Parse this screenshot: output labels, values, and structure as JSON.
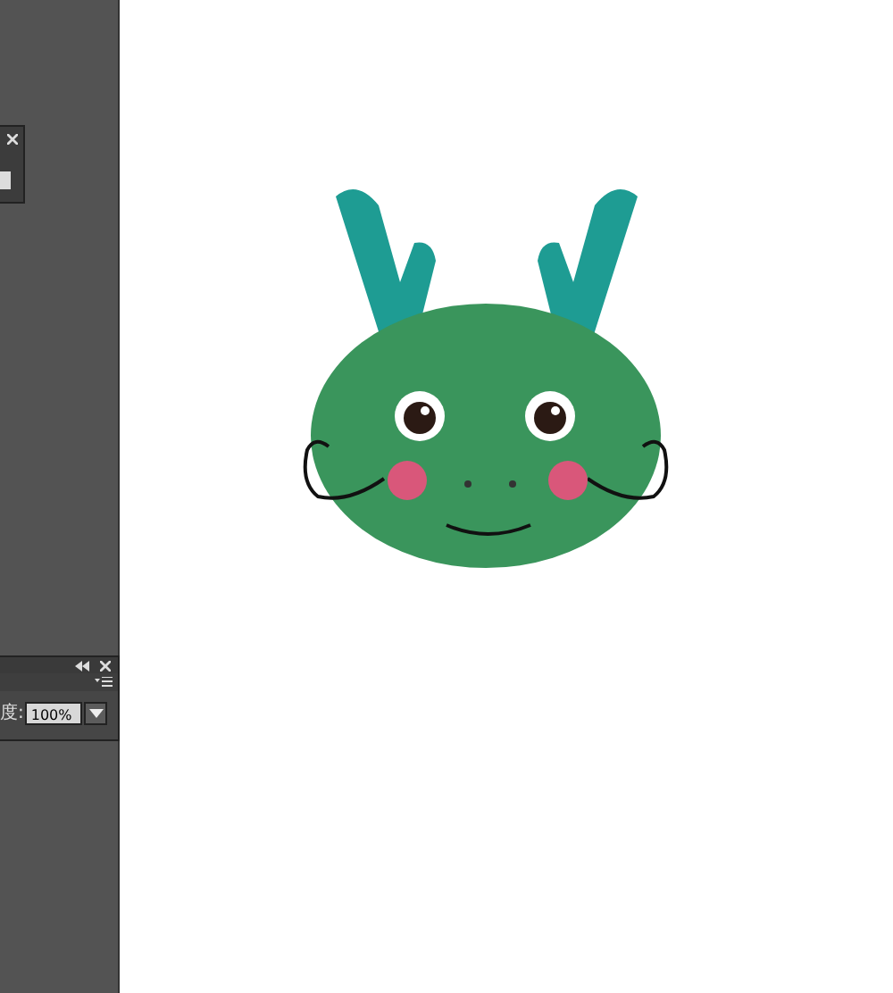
{
  "opacity_panel": {
    "label": "度:",
    "value": "100%"
  }
}
